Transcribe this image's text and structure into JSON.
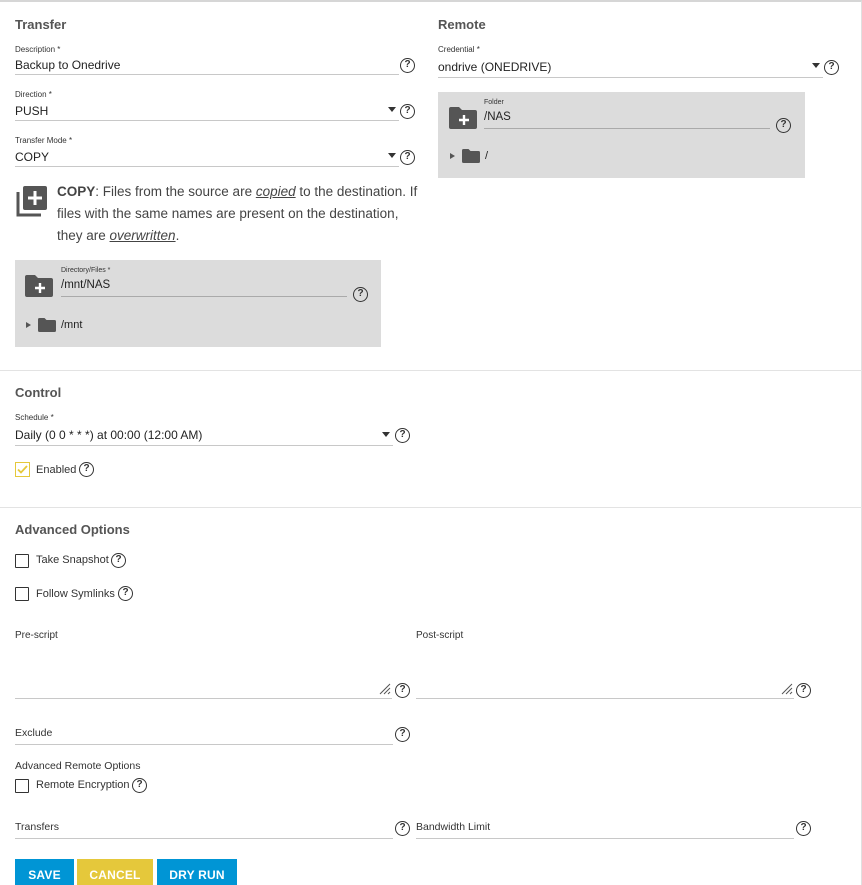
{
  "transfer": {
    "title": "Transfer",
    "description_label": "Description *",
    "description_value": "Backup to Onedrive",
    "direction_label": "Direction *",
    "direction_value": "PUSH",
    "mode_label": "Transfer Mode *",
    "mode_value": "COPY",
    "mode_description": {
      "strong": "COPY",
      "part1": ": Files from the source are ",
      "em1": "copied",
      "part2": " to the destination. If files with the same names are present on the destination, they are ",
      "em2": "overwritten",
      "part3": "."
    },
    "directory_label": "Directory/Files *",
    "directory_value": "/mnt/NAS",
    "directory_tree_item": "/mnt"
  },
  "remote": {
    "title": "Remote",
    "credential_label": "Credential *",
    "credential_value": "ondrive (ONEDRIVE)",
    "folder_label": "Folder",
    "folder_value": "/NAS",
    "folder_tree_item": "/"
  },
  "control": {
    "title": "Control",
    "schedule_label": "Schedule *",
    "schedule_value": "Daily (0 0 * * *) at 00:00 (12:00 AM)",
    "enabled_label": "Enabled",
    "enabled_checked": true
  },
  "advanced": {
    "title": "Advanced Options",
    "take_snapshot_label": "Take Snapshot",
    "follow_symlinks_label": "Follow Symlinks",
    "pre_script_label": "Pre-script",
    "post_script_label": "Post-script",
    "exclude_label": "Exclude",
    "remote_options_title": "Advanced Remote Options",
    "remote_encryption_label": "Remote Encryption",
    "transfers_label": "Transfers",
    "bandwidth_label": "Bandwidth Limit"
  },
  "buttons": {
    "save": "SAVE",
    "cancel": "CANCEL",
    "dry_run": "DRY RUN"
  },
  "help_glyph": "?",
  "colors": {
    "primary": "#0095d5",
    "accent": "#e5c83b",
    "explorer_bg": "#dcdcdc",
    "check": "#e5c83b"
  }
}
